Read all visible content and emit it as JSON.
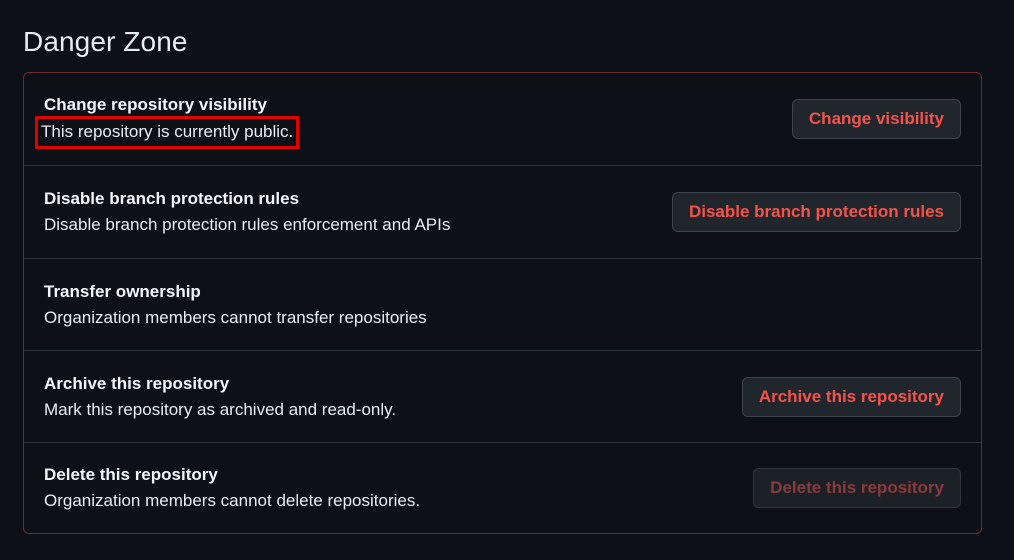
{
  "page": {
    "heading": "Danger Zone"
  },
  "rows": [
    {
      "title": "Change repository visibility",
      "description": "This repository is currently public.",
      "button": "Change visibility"
    },
    {
      "title": "Disable branch protection rules",
      "description": "Disable branch protection rules enforcement and APIs",
      "button": "Disable branch protection rules"
    },
    {
      "title": "Transfer ownership",
      "description": "Organization members cannot transfer repositories"
    },
    {
      "title": "Archive this repository",
      "description": "Mark this repository as archived and read-only.",
      "button": "Archive this repository"
    },
    {
      "title": "Delete this repository",
      "description": "Organization members cannot delete repositories.",
      "button": "Delete this repository",
      "button_disabled": true
    }
  ],
  "colors": {
    "background": "#0d1117",
    "danger_text": "#f85149",
    "danger_border": "#6e2a2e",
    "highlight_box": "#e00000"
  }
}
